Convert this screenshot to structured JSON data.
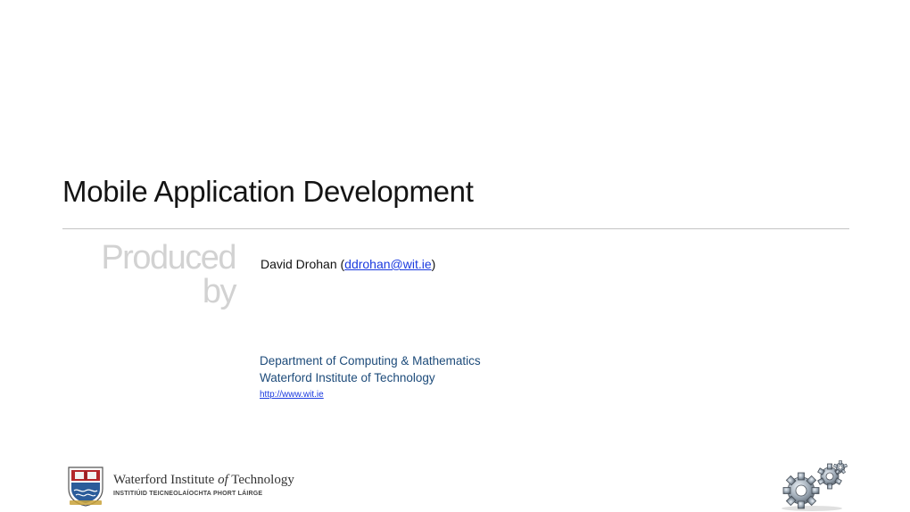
{
  "slide": {
    "title": "Mobile Application Development",
    "produced_by_line1": "Produced",
    "produced_by_line2": "by",
    "author_name": "David Drohan (",
    "author_email": "ddrohan@wit.ie",
    "author_close": ")",
    "department": "Department of Computing & Mathematics",
    "institute": "Waterford Institute of Technology",
    "url": "http://www.wit.ie"
  },
  "logo": {
    "name_prefix": "Waterford Institute ",
    "name_of": "of",
    "name_suffix": " Technology",
    "irish_name": "INSTITIÚID TEICNEOLAÍOCHTA PHORT LÁIRGE"
  },
  "colors": {
    "link": "#1a3adf",
    "department_text": "#1d4b7a",
    "rule": "#c4c4c4",
    "produced_by": "#d2d2d2"
  },
  "icons": {
    "crest": "wit-crest-icon",
    "gears": "gears-icon"
  }
}
